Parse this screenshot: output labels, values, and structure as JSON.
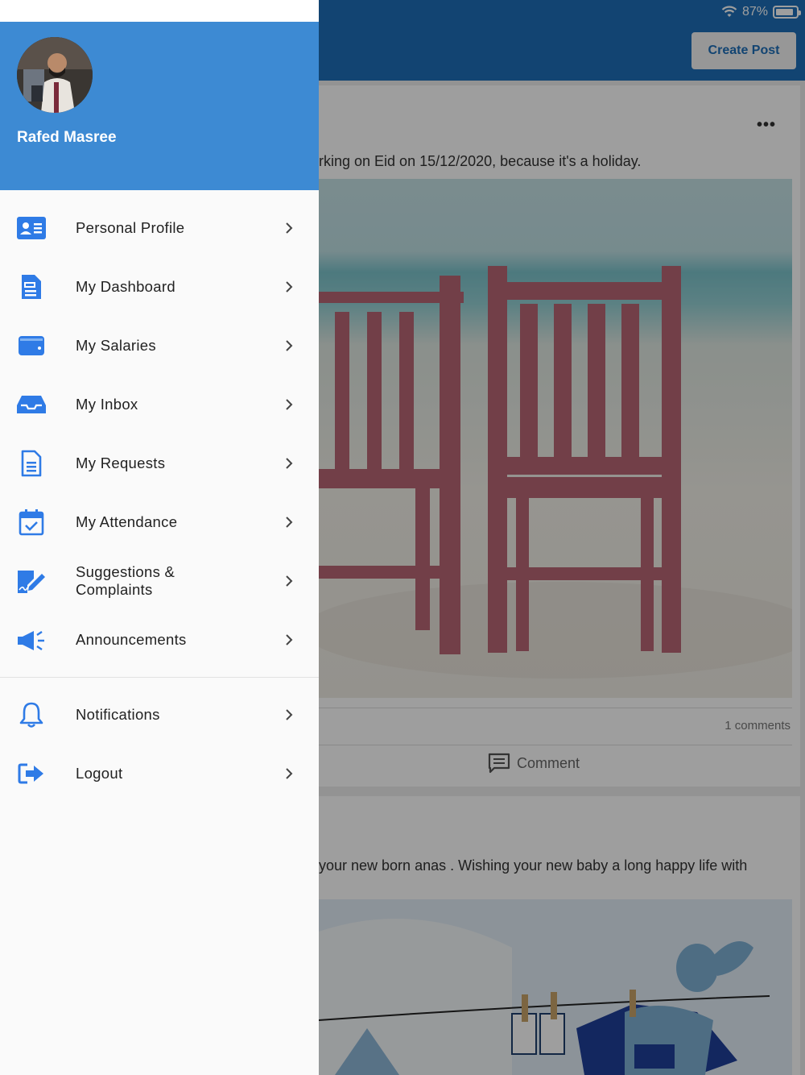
{
  "status_bar": {
    "battery": "87%",
    "battery_level": 0.87
  },
  "app_bar": {
    "create_post_label": "Create Post"
  },
  "posts": [
    {
      "text": "rking on Eid on 15/12/2020, because it's a holiday.",
      "comments_count": "1 comments",
      "comment_label": "Comment"
    },
    {
      "text": "your new born anas . Wishing your new baby a long happy life with"
    }
  ],
  "drawer": {
    "user_name": "Rafed Masree",
    "items": [
      {
        "label": "Personal Profile",
        "icon": "id-card-icon"
      },
      {
        "label": "My Dashboard",
        "icon": "document-list-icon"
      },
      {
        "label": "My Salaries",
        "icon": "wallet-icon"
      },
      {
        "label": "My Inbox",
        "icon": "inbox-tray-icon"
      },
      {
        "label": "My Requests",
        "icon": "document-icon"
      },
      {
        "label": "My Attendance",
        "icon": "calendar-check-icon"
      },
      {
        "label": "Suggestions & Complaints",
        "icon": "signature-pen-icon"
      },
      {
        "label": "Announcements",
        "icon": "megaphone-icon"
      },
      {
        "label": "Notifications",
        "icon": "bell-icon"
      },
      {
        "label": "Logout",
        "icon": "logout-icon"
      }
    ]
  },
  "colors": {
    "primary": "#1e6fb8",
    "drawer_header": "#3d8ad3",
    "icon_blue": "#2f7be6"
  }
}
